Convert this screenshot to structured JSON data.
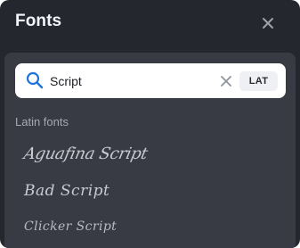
{
  "header": {
    "title": "Fonts",
    "close_icon": "close-icon"
  },
  "search": {
    "icon": "search-icon",
    "value": "Script",
    "clear_icon": "clear-icon",
    "language_button": "LAT"
  },
  "section": {
    "label": "Latin fonts"
  },
  "fonts": [
    {
      "name": "Aguafina Script"
    },
    {
      "name": "Bad Script"
    },
    {
      "name": "Clicker Script"
    }
  ],
  "colors": {
    "panel_background": "#25272f",
    "content_background": "#383a44",
    "accent_search_icon": "#1e74d8"
  }
}
